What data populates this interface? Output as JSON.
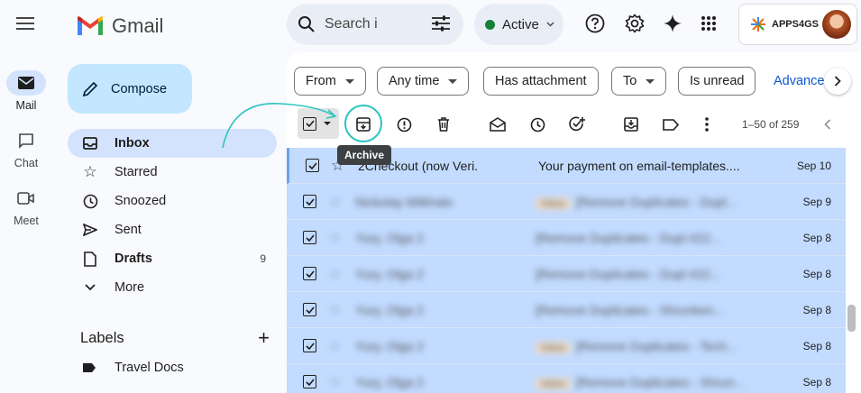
{
  "app": {
    "name": "Gmail"
  },
  "rail": [
    {
      "label": "Mail",
      "icon": "mail-icon",
      "active": true
    },
    {
      "label": "Chat",
      "icon": "chat-icon",
      "active": false
    },
    {
      "label": "Meet",
      "icon": "meet-icon",
      "active": false
    }
  ],
  "compose_label": "Compose",
  "nav": {
    "inbox": "Inbox",
    "starred": "Starred",
    "snoozed": "Snoozed",
    "sent": "Sent",
    "drafts": "Drafts",
    "drafts_count": "9",
    "more": "More"
  },
  "labels": {
    "title": "Labels",
    "item": "Travel Docs"
  },
  "search": {
    "placeholder": "Search i"
  },
  "status": {
    "label": "Active",
    "color": "#188038"
  },
  "account": {
    "name": "APPS4GS"
  },
  "filters": {
    "from": "From",
    "any_time": "Any time",
    "has_attachment": "Has attachment",
    "to": "To",
    "is_unread": "Is unread",
    "advanced": "Advance"
  },
  "toolbar": {
    "tooltip": "Archive",
    "range": "1–50 of 259"
  },
  "emails": [
    {
      "sender": "2Checkout (now Veri.",
      "subject": "Your payment on email-templates....",
      "date": "Sep 10",
      "blurred": false,
      "tag": ""
    },
    {
      "sender": "Nickolay Milkhalo",
      "subject": "[Remove Duplicates - Dupl...",
      "date": "Sep 9",
      "blurred": true,
      "tag": "Inbox"
    },
    {
      "sender": "Yury, Olga 2",
      "subject": "[Remove Duplicates - Dupl #22...",
      "date": "Sep 8",
      "blurred": true,
      "tag": ""
    },
    {
      "sender": "Yury, Olga 2",
      "subject": "[Remove Duplicates - Dupl #22...",
      "date": "Sep 8",
      "blurred": true,
      "tag": ""
    },
    {
      "sender": "Yury, Olga 2",
      "subject": "[Remove Duplicates - Shrunken...",
      "date": "Sep 8",
      "blurred": true,
      "tag": ""
    },
    {
      "sender": "Yury, Olga 2",
      "subject": "[Remove Duplicates - Tech...",
      "date": "Sep 8",
      "blurred": true,
      "tag": "Inbox"
    },
    {
      "sender": "Yury, Olga 2",
      "subject": "[Remove Duplicates - Shrun...",
      "date": "Sep 8",
      "blurred": true,
      "tag": "Inbox"
    }
  ],
  "colors": {
    "accent": "#2cc4bf",
    "selected_row": "#c2dbff",
    "compose": "#c2e7ff"
  }
}
